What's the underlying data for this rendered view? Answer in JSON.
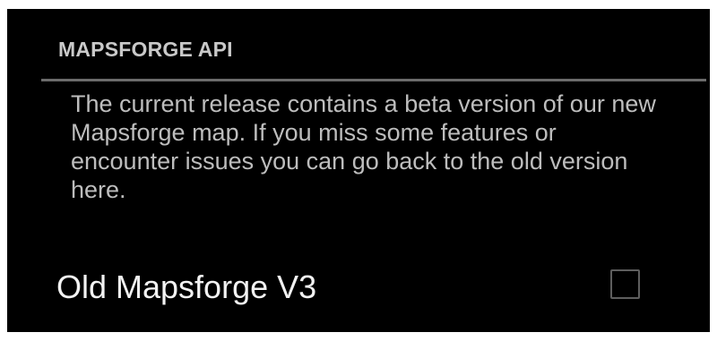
{
  "section": {
    "header": "MAPSFORGE API",
    "description": "The current release contains a beta version of our new Mapsforge map. If you miss some features or encounter issues you can go back to the old version here."
  },
  "preference": {
    "label": "Old Mapsforge V3",
    "checked": false
  },
  "colors": {
    "background": "#000000",
    "header_text": "#c9c9c9",
    "description_text": "#bdbdbd",
    "label_text": "#f2f2f2",
    "divider": "#6b6b6b",
    "checkbox_border": "#5e5e5e"
  }
}
